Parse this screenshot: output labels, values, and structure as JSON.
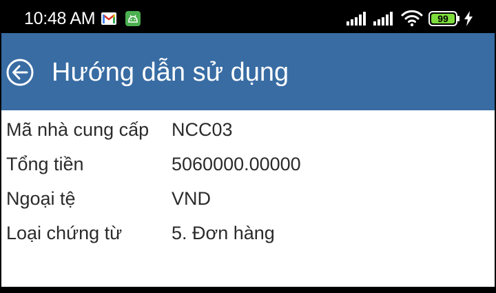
{
  "status_bar": {
    "time": "10:48 AM",
    "battery_level": "99",
    "icons": [
      "gmail-icon",
      "android-app-icon",
      "signal-icon",
      "signal-icon",
      "wifi-icon",
      "battery-icon",
      "charging-icon"
    ]
  },
  "app_bar": {
    "title": "Hướng dẫn sử dụng",
    "back_icon": "back-arrow-circle-icon"
  },
  "details": [
    {
      "label": "Mã nhà cung cấp",
      "value": "NCC03"
    },
    {
      "label": "Tổng tiền",
      "value": "5060000.00000"
    },
    {
      "label": "Ngoại tệ",
      "value": "VND"
    },
    {
      "label": "Loại chứng từ",
      "value": "5. Đơn hàng"
    }
  ],
  "colors": {
    "app_bar": "#386ca3",
    "background": "#ffffff",
    "text": "#2b2b2b",
    "status_bar": "#000000"
  }
}
